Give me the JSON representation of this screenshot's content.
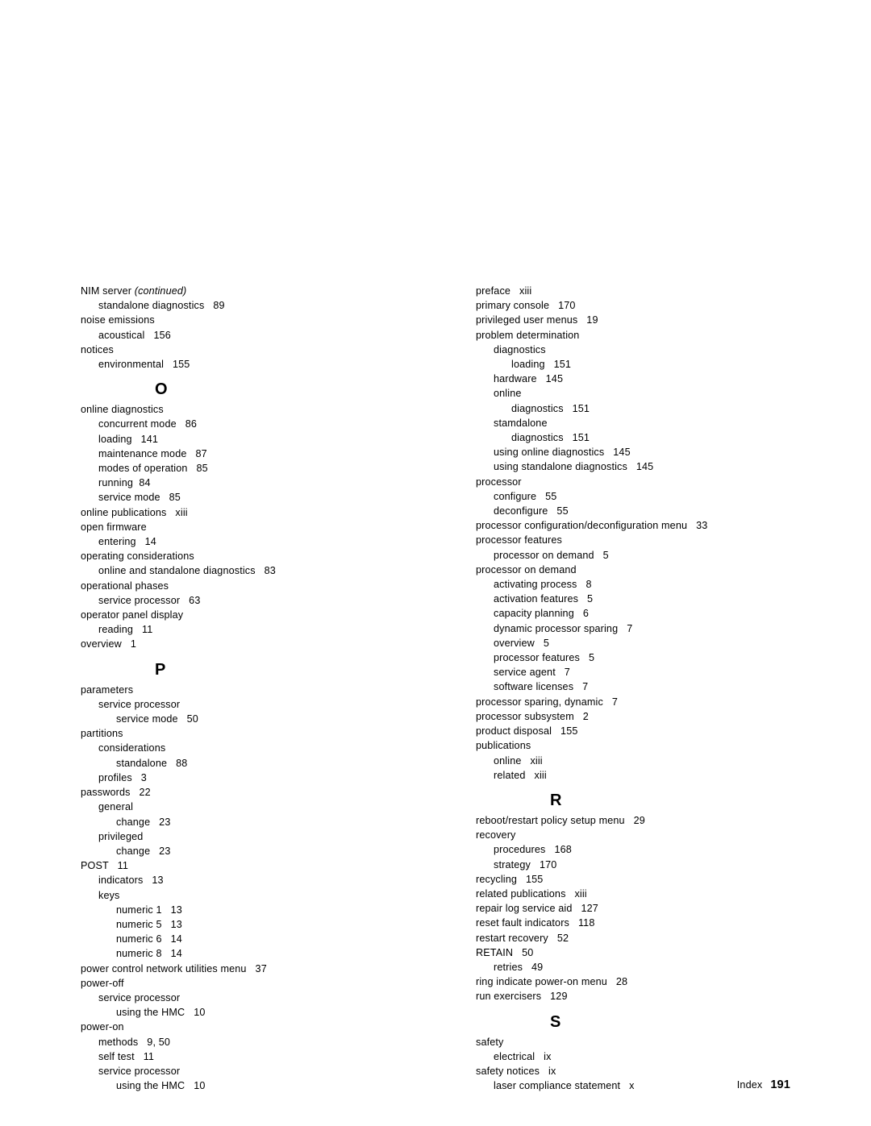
{
  "document": {
    "footer": {
      "label": "Index",
      "page_number": "191"
    },
    "left_column": [
      {
        "level": 0,
        "text": "NIM server ",
        "italic_suffix": "(continued)"
      },
      {
        "level": 1,
        "text": "standalone diagnostics   89"
      },
      {
        "level": 0,
        "text": "noise emissions"
      },
      {
        "level": 1,
        "text": "acoustical   156"
      },
      {
        "level": 0,
        "text": "notices"
      },
      {
        "level": 1,
        "text": "environmental   155"
      },
      {
        "level": "letter",
        "text": "O"
      },
      {
        "level": 0,
        "text": "online diagnostics"
      },
      {
        "level": 1,
        "text": "concurrent mode   86"
      },
      {
        "level": 1,
        "text": "loading   141"
      },
      {
        "level": 1,
        "text": "maintenance mode   87"
      },
      {
        "level": 1,
        "text": "modes of operation   85"
      },
      {
        "level": 1,
        "text": "running  84"
      },
      {
        "level": 1,
        "text": "service mode   85"
      },
      {
        "level": 0,
        "text": "online publications   xiii"
      },
      {
        "level": 0,
        "text": "open firmware"
      },
      {
        "level": 1,
        "text": "entering   14"
      },
      {
        "level": 0,
        "text": "operating considerations"
      },
      {
        "level": 1,
        "text": "online and standalone diagnostics   83"
      },
      {
        "level": 0,
        "text": "operational phases"
      },
      {
        "level": 1,
        "text": "service processor   63"
      },
      {
        "level": 0,
        "text": "operator panel display"
      },
      {
        "level": 1,
        "text": "reading   11"
      },
      {
        "level": 0,
        "text": "overview   1"
      },
      {
        "level": "letter",
        "text": "P"
      },
      {
        "level": 0,
        "text": "parameters"
      },
      {
        "level": 1,
        "text": "service processor"
      },
      {
        "level": 2,
        "text": "service mode   50"
      },
      {
        "level": 0,
        "text": "partitions"
      },
      {
        "level": 1,
        "text": "considerations"
      },
      {
        "level": 2,
        "text": "standalone   88"
      },
      {
        "level": 1,
        "text": "profiles   3"
      },
      {
        "level": 0,
        "text": "passwords   22"
      },
      {
        "level": 1,
        "text": "general"
      },
      {
        "level": 2,
        "text": "change   23"
      },
      {
        "level": 1,
        "text": "privileged"
      },
      {
        "level": 2,
        "text": "change   23"
      },
      {
        "level": 0,
        "text": "POST   11"
      },
      {
        "level": 1,
        "text": "indicators   13"
      },
      {
        "level": 1,
        "text": "keys"
      },
      {
        "level": 2,
        "text": "numeric 1   13"
      },
      {
        "level": 2,
        "text": "numeric 5   13"
      },
      {
        "level": 2,
        "text": "numeric 6   14"
      },
      {
        "level": 2,
        "text": "numeric 8   14"
      },
      {
        "level": 0,
        "text": "power control network utilities menu   37"
      },
      {
        "level": 0,
        "text": "power-off"
      },
      {
        "level": 1,
        "text": "service processor"
      },
      {
        "level": 2,
        "text": "using the HMC   10"
      },
      {
        "level": 0,
        "text": "power-on"
      },
      {
        "level": 1,
        "text": "methods   9, 50"
      },
      {
        "level": 1,
        "text": "self test   11"
      },
      {
        "level": 1,
        "text": "service processor"
      },
      {
        "level": 2,
        "text": "using the HMC   10"
      }
    ],
    "right_column": [
      {
        "level": 0,
        "text": "preface   xiii"
      },
      {
        "level": 0,
        "text": "primary console   170"
      },
      {
        "level": 0,
        "text": "privileged user menus   19"
      },
      {
        "level": 0,
        "text": "problem determination"
      },
      {
        "level": 1,
        "text": "diagnostics"
      },
      {
        "level": 2,
        "text": "loading   151"
      },
      {
        "level": 1,
        "text": "hardware   145"
      },
      {
        "level": 1,
        "text": "online"
      },
      {
        "level": 2,
        "text": "diagnostics   151"
      },
      {
        "level": 1,
        "text": "stamdalone"
      },
      {
        "level": 2,
        "text": "diagnostics   151"
      },
      {
        "level": 1,
        "text": "using online diagnostics   145"
      },
      {
        "level": 1,
        "text": "using standalone diagnostics   145"
      },
      {
        "level": 0,
        "text": "processor"
      },
      {
        "level": 1,
        "text": "configure   55"
      },
      {
        "level": 1,
        "text": "deconfigure   55"
      },
      {
        "level": 0,
        "text": "processor configuration/deconfiguration menu   33"
      },
      {
        "level": 0,
        "text": "processor features"
      },
      {
        "level": 1,
        "text": "processor on demand   5"
      },
      {
        "level": 0,
        "text": "processor on demand"
      },
      {
        "level": 1,
        "text": "activating process   8"
      },
      {
        "level": 1,
        "text": "activation features   5"
      },
      {
        "level": 1,
        "text": "capacity planning   6"
      },
      {
        "level": 1,
        "text": "dynamic processor sparing   7"
      },
      {
        "level": 1,
        "text": "overview   5"
      },
      {
        "level": 1,
        "text": "processor features   5"
      },
      {
        "level": 1,
        "text": "service agent   7"
      },
      {
        "level": 1,
        "text": "software licenses   7"
      },
      {
        "level": 0,
        "text": "processor sparing, dynamic   7"
      },
      {
        "level": 0,
        "text": "processor subsystem   2"
      },
      {
        "level": 0,
        "text": "product disposal   155"
      },
      {
        "level": 0,
        "text": "publications"
      },
      {
        "level": 1,
        "text": "online   xiii"
      },
      {
        "level": 1,
        "text": "related   xiii"
      },
      {
        "level": "letter",
        "text": "R"
      },
      {
        "level": 0,
        "text": "reboot/restart policy setup menu   29"
      },
      {
        "level": 0,
        "text": "recovery"
      },
      {
        "level": 1,
        "text": "procedures   168"
      },
      {
        "level": 1,
        "text": "strategy   170"
      },
      {
        "level": 0,
        "text": "recycling   155"
      },
      {
        "level": 0,
        "text": "related publications   xiii"
      },
      {
        "level": 0,
        "text": "repair log service aid   127"
      },
      {
        "level": 0,
        "text": "reset fault indicators   118"
      },
      {
        "level": 0,
        "text": "restart recovery   52"
      },
      {
        "level": 0,
        "text": "RETAIN   50"
      },
      {
        "level": 1,
        "text": "retries   49"
      },
      {
        "level": 0,
        "text": "ring indicate power-on menu   28"
      },
      {
        "level": 0,
        "text": "run exercisers   129"
      },
      {
        "level": "letter",
        "text": "S"
      },
      {
        "level": 0,
        "text": "safety"
      },
      {
        "level": 1,
        "text": "electrical   ix"
      },
      {
        "level": 0,
        "text": "safety notices   ix"
      },
      {
        "level": 1,
        "text": "laser compliance statement   x"
      }
    ]
  }
}
